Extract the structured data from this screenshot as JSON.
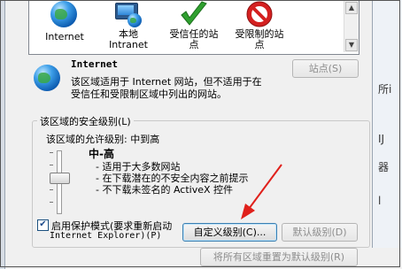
{
  "zones": [
    {
      "label": "Internet",
      "icon": "globe-icon"
    },
    {
      "label": "本地\nIntranet",
      "icon": "intranet-icon"
    },
    {
      "label": "受信任的站\n点",
      "icon": "green-check-icon"
    },
    {
      "label": "受限制的站\n点",
      "icon": "restricted-icon"
    }
  ],
  "zone_info": {
    "title": "Internet",
    "description_line1": "该区域适用于 Internet 网站，但不适用于在",
    "description_line2": "受信任和受限制区域中列出的网站。",
    "sites_button": "站点(S)"
  },
  "security": {
    "group_title": "该区域的安全级别(L)",
    "allowed_levels": "该区域的允许级别: 中到高",
    "level_name": "中-高",
    "bullets": [
      "- 适用于大多数网站",
      "- 在下载潜在的不安全内容之前提示",
      "- 不下载未签名的 ActiveX 控件"
    ],
    "protected_mode_line1": "启用保护模式(要求重新启动",
    "protected_mode_line2": "Internet Explorer)(P)",
    "protected_mode_checked": "✔",
    "custom_button": "自定义级别(C)...",
    "default_button": "默认级别(D)"
  },
  "bottom": {
    "reset_all_button": "将所有区域重置为默认级别(R)"
  },
  "right_panel": {
    "text1": "所i",
    "text2": "IJ",
    "text3": "器",
    "text4": "l"
  },
  "colors": {
    "accent_red": "#e0201b",
    "check_green": "#2fa02f",
    "restricted_red": "#d42020"
  }
}
